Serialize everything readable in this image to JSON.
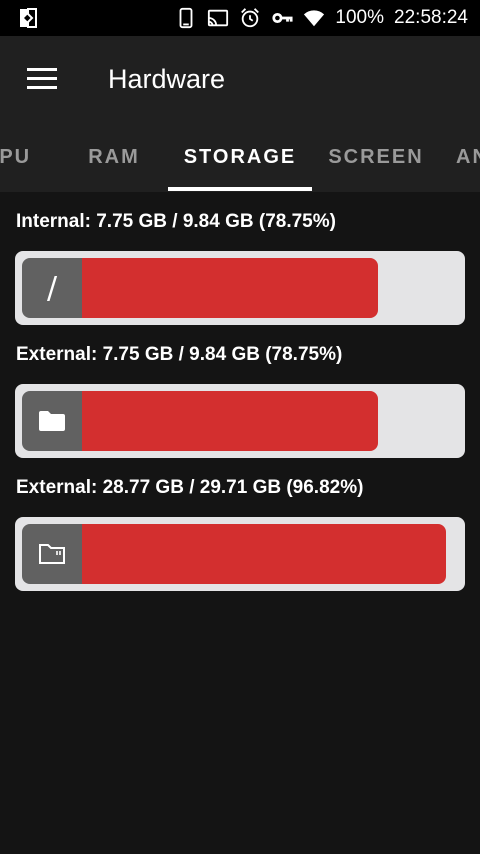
{
  "status_bar": {
    "battery_text": "100%",
    "time": "22:58:24",
    "icons": [
      "nfc-icon",
      "phone-icon",
      "cast-icon",
      "alarm-icon",
      "vpn-key-icon",
      "wifi-icon"
    ]
  },
  "app_bar": {
    "title": "Hardware",
    "menu_icon": "hamburger-menu-icon"
  },
  "tabs": [
    {
      "label": "CPU",
      "active": false
    },
    {
      "label": "RAM",
      "active": false
    },
    {
      "label": "STORAGE",
      "active": true
    },
    {
      "label": "SCREEN",
      "active": false
    },
    {
      "label": "AN",
      "active": false
    }
  ],
  "storage": [
    {
      "label": "Internal: 7.75 GB / 9.84 GB (78.75%)",
      "icon": "slash-root-icon",
      "icon_glyph": "/",
      "percent": 78.75
    },
    {
      "label": "External: 7.75 GB / 9.84 GB (78.75%)",
      "icon": "folder-icon",
      "percent": 78.75
    },
    {
      "label": "External: 28.77 GB / 29.71 GB (96.82%)",
      "icon": "sd-card-icon",
      "percent": 96.82
    }
  ],
  "colors": {
    "background": "#141414",
    "app_bar": "#202020",
    "bar_fill": "#d32f2f",
    "bar_track": "#e4e4e6",
    "icon_box": "#616161"
  }
}
